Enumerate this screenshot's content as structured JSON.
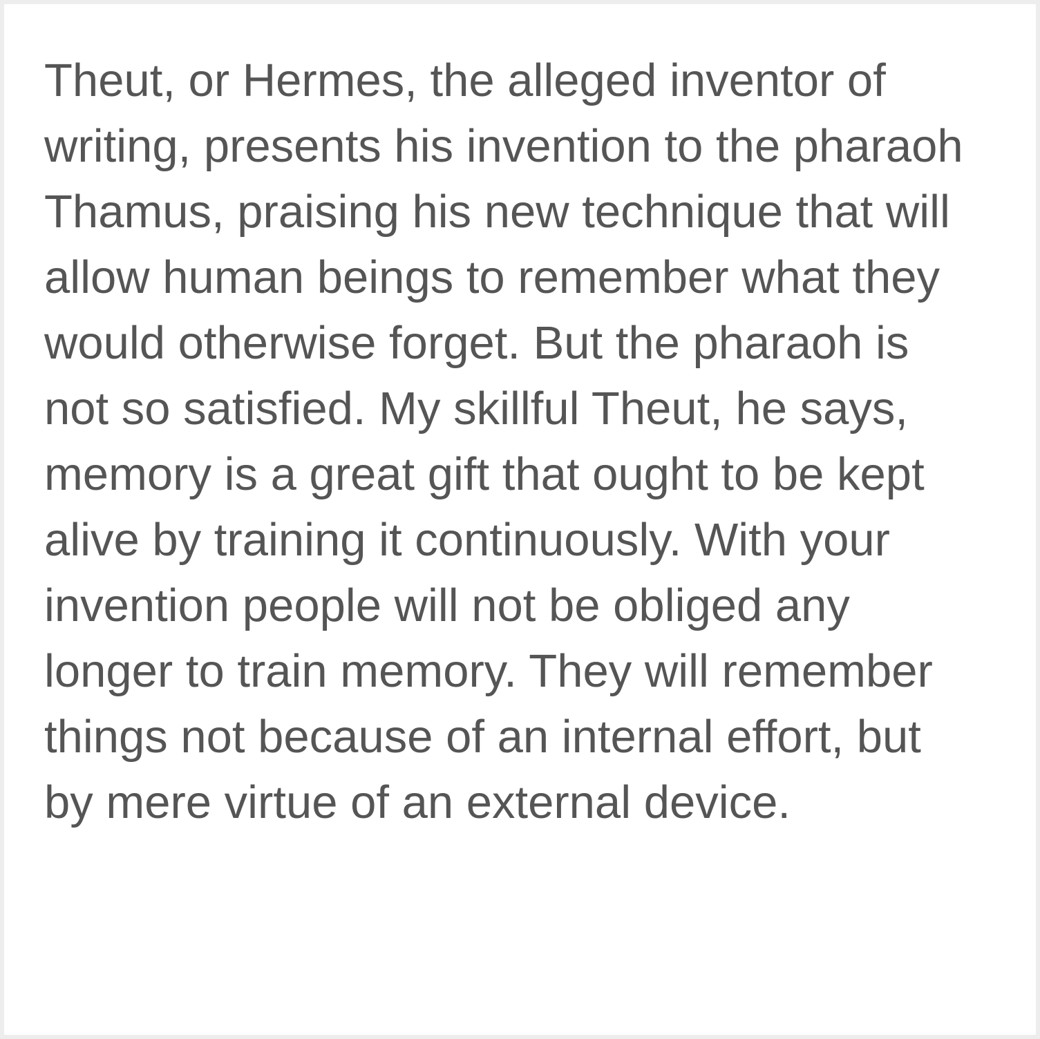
{
  "document": {
    "text_color": "#555555",
    "background": "#ffffff",
    "lines": [
      "Theut, or Hermes, the alleged inventor of",
      "writing, presents his invention to the pharaoh",
      "Thamus, praising his new technique that will",
      "allow human beings to remember what they",
      "would otherwise forget. But the pharaoh is",
      "not so satisfied. My skillful Theut, he says,",
      "memory is a great gift that ought to be kept",
      "alive by training it continuously. With your",
      "invention people will not be obliged any",
      "longer to train memory. They will remember",
      "things not because of an internal effort, but",
      "by mere virtue of an external device."
    ]
  }
}
